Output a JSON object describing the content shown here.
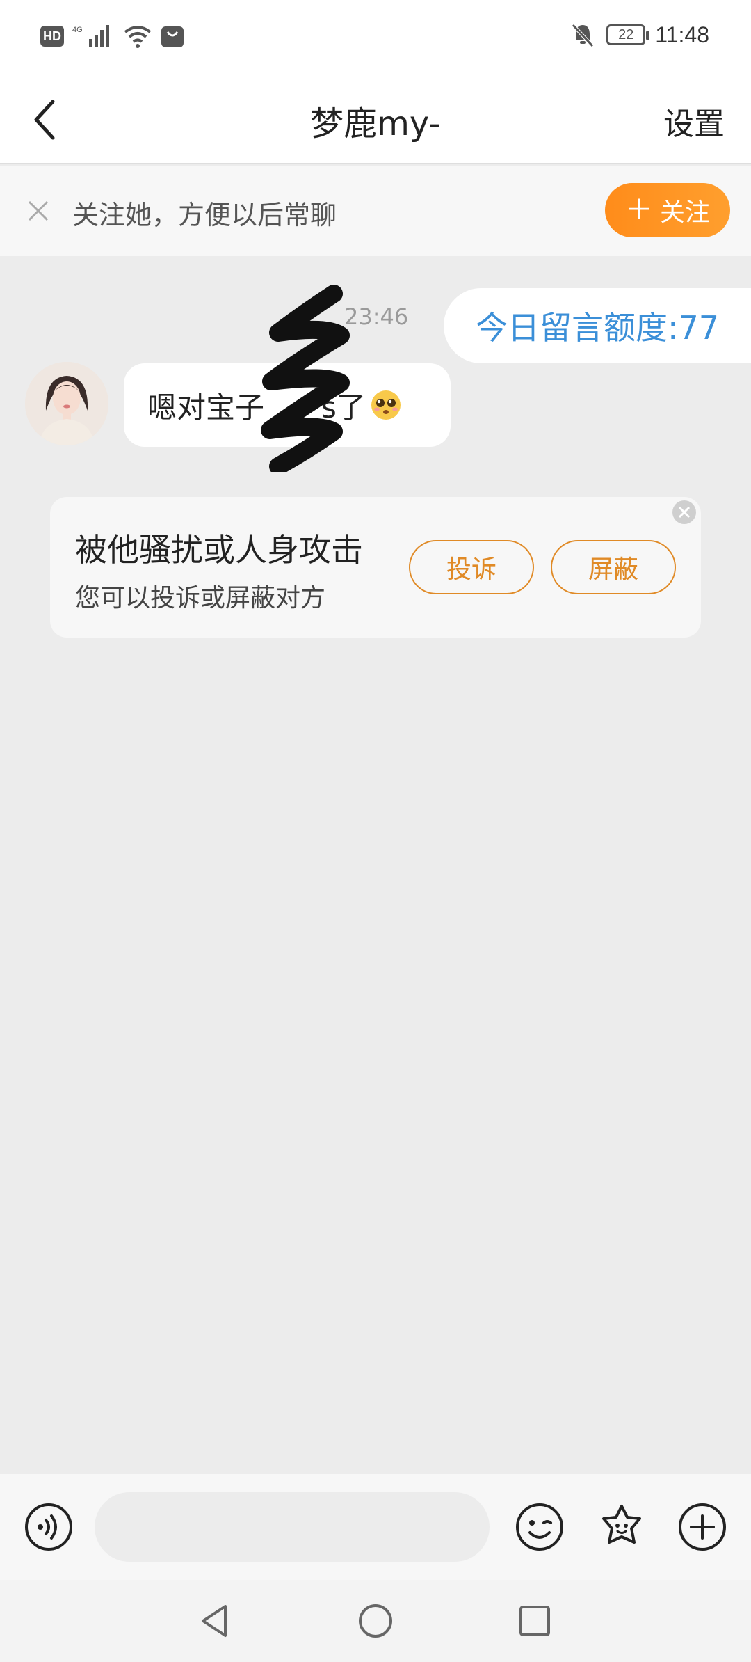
{
  "status_bar": {
    "hd_label": "HD",
    "network_label": "4G",
    "battery_level": "22",
    "time": "11:48"
  },
  "nav": {
    "title": "梦鹿my-",
    "settings_label": "设置"
  },
  "follow_banner": {
    "text": "关注她，方便以后常聊",
    "button_label": "关注"
  },
  "chat": {
    "timestamp": "23:46",
    "quota_text": "今日留言额度:77",
    "messages": [
      {
        "text_before": "嗯对宝子",
        "text_after": "s了",
        "emoji": "pleading-face"
      }
    ]
  },
  "safety_card": {
    "title": "被他骚扰或人身攻击",
    "subtitle": "您可以投诉或屏蔽对方",
    "report_label": "投诉",
    "block_label": "屏蔽"
  },
  "input_bar": {
    "placeholder": ""
  },
  "colors": {
    "accent_orange": "#ff8c1a",
    "quota_blue": "#3b8fd8",
    "chat_background": "#ececec"
  }
}
